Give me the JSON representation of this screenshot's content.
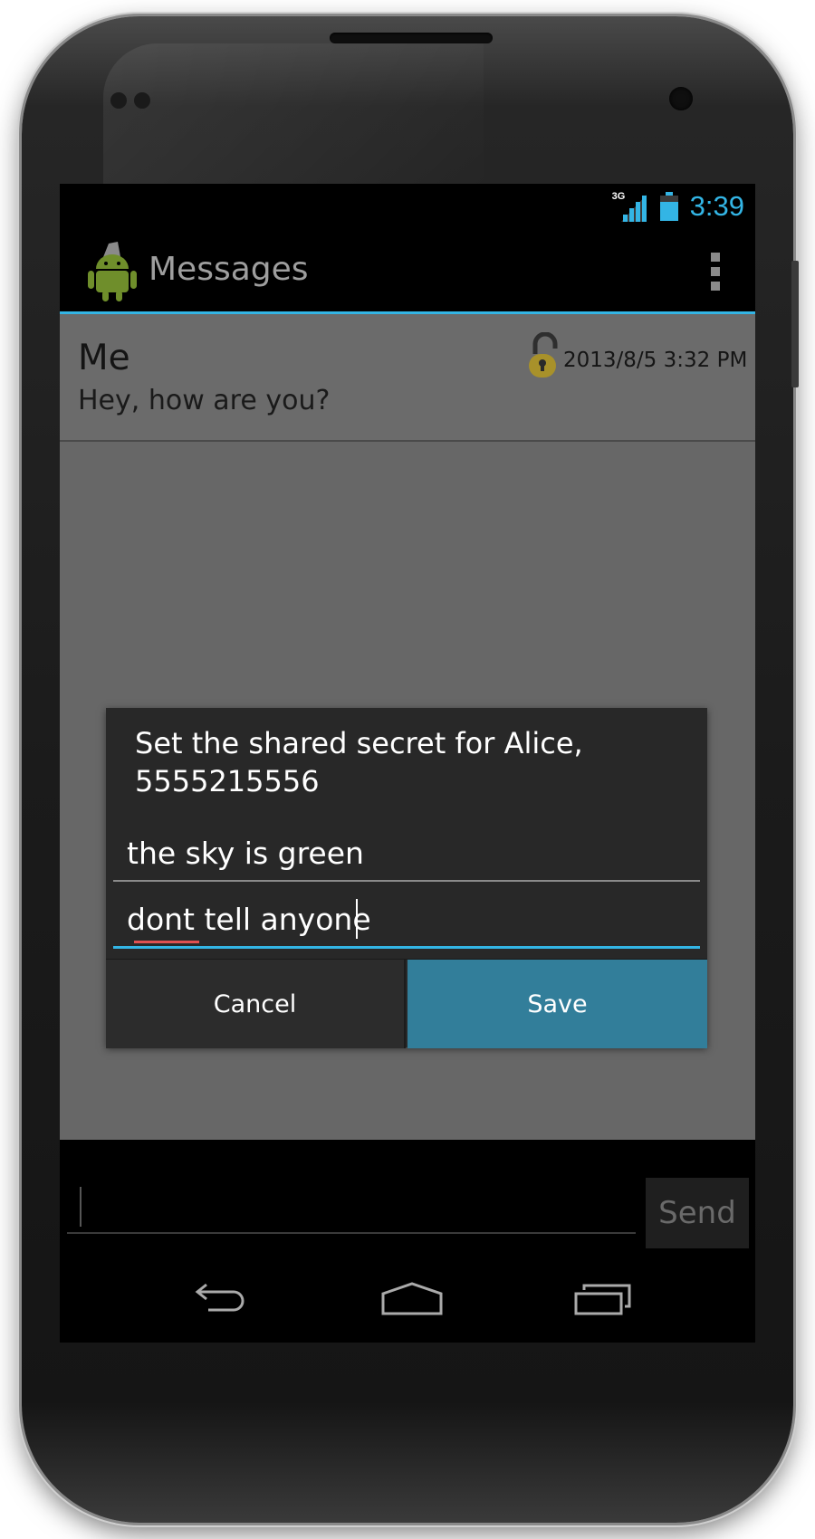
{
  "status_bar": {
    "network_label": "3G",
    "clock": "3:39",
    "accent_color": "#33b5e5"
  },
  "action_bar": {
    "app_icon": "android-robot-icon",
    "title": "Messages",
    "overflow_icon": "overflow-menu-icon"
  },
  "message": {
    "sender": "Me",
    "body": "Hey, how are you?",
    "lock_icon": "unlocked-padlock-icon",
    "timestamp": "2013/8/5 3:32 PM"
  },
  "dialog": {
    "title_line1": "Set the shared secret for Alice,",
    "title_line2": "5555215556",
    "field1_value": "the sky is green",
    "field2_value": "dont tell anyone",
    "cancel_label": "Cancel",
    "save_label": "Save",
    "save_color": "#327e9a"
  },
  "compose": {
    "input_value": "",
    "send_label": "Send"
  },
  "nav_bar": {
    "back_icon": "back-icon",
    "home_icon": "home-icon",
    "recent_icon": "recent-apps-icon"
  }
}
